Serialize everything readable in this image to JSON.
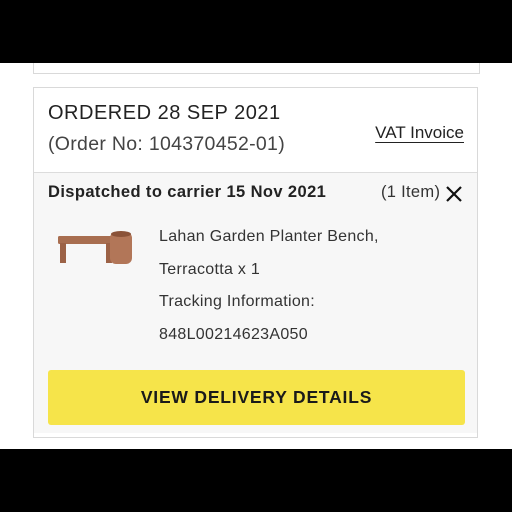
{
  "order": {
    "ordered_date": "ORDERED 28 SEP 2021",
    "order_number": "(Order No: 104370452-01)",
    "vat_invoice_label": "VAT Invoice"
  },
  "shipment": {
    "status": "Dispatched to carrier 15 Nov 2021",
    "item_count": "(1 Item)",
    "close_icon": "close-icon",
    "product": {
      "name_line1": "Lahan Garden Planter Bench,",
      "name_line2": "Terracotta x 1",
      "tracking_label": "Tracking Information:",
      "tracking_number": "848L00214623A050",
      "thumb_color": "#a86e50"
    },
    "cta_label": "VIEW DELIVERY DETAILS",
    "cta_color": "#f6e44a"
  }
}
